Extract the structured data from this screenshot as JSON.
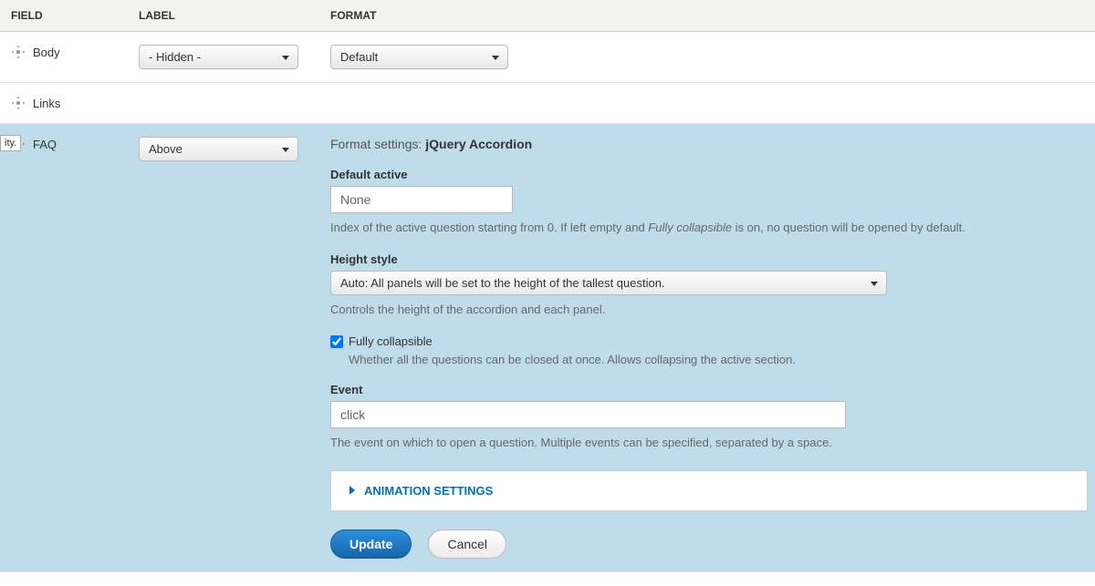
{
  "columns": {
    "field": "FIELD",
    "label": "LABEL",
    "format": "FORMAT"
  },
  "rows": [
    {
      "name": "Body",
      "label_select": "- Hidden -",
      "format_select": "Default"
    },
    {
      "name": "Links"
    },
    {
      "name": "FAQ",
      "label_select": "Above"
    }
  ],
  "tooltip": "ity.",
  "format_settings": {
    "title_prefix": "Format settings:",
    "title_value": "jQuery Accordion",
    "default_active": {
      "label": "Default active",
      "value": "None",
      "help_before": "Index of the active question starting from 0. If left empty and ",
      "help_italic": "Fully collapsible",
      "help_after": " is on, no question will be opened by default."
    },
    "height_style": {
      "label": "Height style",
      "value": "Auto: All panels will be set to the height of the tallest question.",
      "help": "Controls the height of the accordion and each panel."
    },
    "fully_collapsible": {
      "checked": true,
      "label": "Fully collapsible",
      "help": "Whether all the questions can be closed at once. Allows collapsing the active section."
    },
    "event": {
      "label": "Event",
      "value": "click",
      "help": "The event on which to open a question. Multiple events can be specified, separated by a space."
    },
    "animation_fieldset": "ANIMATION SETTINGS",
    "actions": {
      "update": "Update",
      "cancel": "Cancel"
    }
  }
}
